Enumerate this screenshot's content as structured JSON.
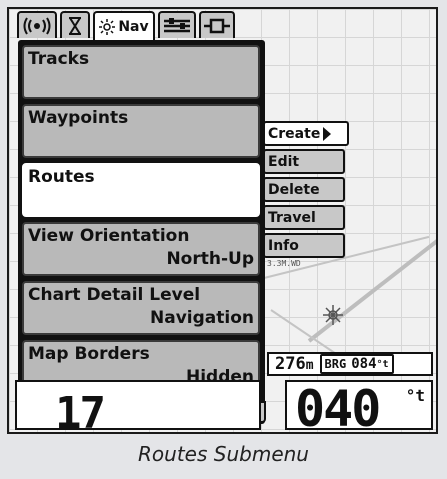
{
  "tabs": [
    {
      "icon": "sonar-icon",
      "label": ""
    },
    {
      "icon": "hourglass-icon",
      "label": ""
    },
    {
      "icon": "sun-icon",
      "label": "Nav",
      "active": true
    },
    {
      "icon": "setup-sliders-icon",
      "label": ""
    },
    {
      "icon": "accessories-plug-icon",
      "label": ""
    }
  ],
  "menu": {
    "items": [
      {
        "title": "Tracks",
        "value": ""
      },
      {
        "title": "Waypoints",
        "value": ""
      },
      {
        "title": "Routes",
        "value": "",
        "selected": true
      },
      {
        "title": "View Orientation",
        "value": "North-Up"
      },
      {
        "title": "Chart Detail Level",
        "value": "Navigation"
      },
      {
        "title": "Map Borders",
        "value": "Hidden"
      }
    ]
  },
  "submenu": {
    "items": [
      {
        "label": "Create",
        "selected": true
      },
      {
        "label": "Edit"
      },
      {
        "label": "Delete"
      },
      {
        "label": "Travel"
      },
      {
        "label": "Info"
      }
    ]
  },
  "readout": {
    "distance_value": "276",
    "distance_unit": "m",
    "brg_label": "BRG",
    "brg_value": "084",
    "brg_unit": "°t"
  },
  "bottom": {
    "left_digits": "17",
    "heading_value": "040",
    "heading_unit": "°t"
  },
  "map": {
    "waypoint_label": "3.3M.WD"
  },
  "caption": "Routes Submenu",
  "colors": {
    "menu_bg": "#b9b9b9",
    "selected_bg": "#ffffff",
    "border": "#111111"
  }
}
